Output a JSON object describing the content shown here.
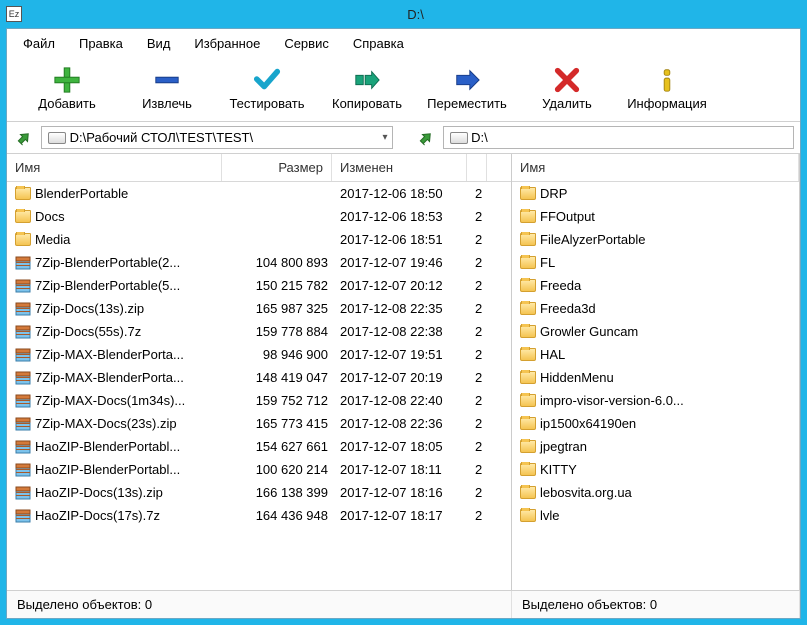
{
  "app_icon_text": "Ez",
  "window_title": "D:\\",
  "menu": [
    "Файл",
    "Правка",
    "Вид",
    "Избранное",
    "Сервис",
    "Справка"
  ],
  "toolbar": [
    {
      "key": "add",
      "label": "Добавить",
      "icon": "plus-icon"
    },
    {
      "key": "extract",
      "label": "Извлечь",
      "icon": "minus-icon"
    },
    {
      "key": "test",
      "label": "Тестировать",
      "icon": "check-icon"
    },
    {
      "key": "copy",
      "label": "Копировать",
      "icon": "copy-icon"
    },
    {
      "key": "move",
      "label": "Переместить",
      "icon": "move-icon"
    },
    {
      "key": "delete",
      "label": "Удалить",
      "icon": "delete-icon"
    },
    {
      "key": "info",
      "label": "Информация",
      "icon": "info-icon"
    }
  ],
  "panes": {
    "left": {
      "path": "D:\\Рабочий СТОЛ\\TEST\\TEST\\",
      "columns": [
        "Имя",
        "Размер",
        "Изменен",
        ""
      ],
      "status": "Выделено объектов: 0",
      "rows": [
        {
          "type": "folder",
          "name": "BlenderPortable",
          "size": "",
          "date": "2017-12-06 18:50",
          "x": "2"
        },
        {
          "type": "folder",
          "name": "Docs",
          "size": "",
          "date": "2017-12-06 18:53",
          "x": "2"
        },
        {
          "type": "folder",
          "name": "Media",
          "size": "",
          "date": "2017-12-06 18:51",
          "x": "2"
        },
        {
          "type": "arch",
          "name": "7Zip-BlenderPortable(2...",
          "size": "104 800 893",
          "date": "2017-12-07 19:46",
          "x": "2"
        },
        {
          "type": "arch",
          "name": "7Zip-BlenderPortable(5...",
          "size": "150 215 782",
          "date": "2017-12-07 20:12",
          "x": "2"
        },
        {
          "type": "arch",
          "name": "7Zip-Docs(13s).zip",
          "size": "165 987 325",
          "date": "2017-12-08 22:35",
          "x": "2"
        },
        {
          "type": "arch",
          "name": "7Zip-Docs(55s).7z",
          "size": "159 778 884",
          "date": "2017-12-08 22:38",
          "x": "2"
        },
        {
          "type": "arch",
          "name": "7Zip-MAX-BlenderPorta...",
          "size": "98 946 900",
          "date": "2017-12-07 19:51",
          "x": "2"
        },
        {
          "type": "arch",
          "name": "7Zip-MAX-BlenderPorta...",
          "size": "148 419 047",
          "date": "2017-12-07 20:19",
          "x": "2"
        },
        {
          "type": "arch",
          "name": "7Zip-MAX-Docs(1m34s)...",
          "size": "159 752 712",
          "date": "2017-12-08 22:40",
          "x": "2"
        },
        {
          "type": "arch",
          "name": "7Zip-MAX-Docs(23s).zip",
          "size": "165 773 415",
          "date": "2017-12-08 22:36",
          "x": "2"
        },
        {
          "type": "arch",
          "name": "HaoZIP-BlenderPortabl...",
          "size": "154 627 661",
          "date": "2017-12-07 18:05",
          "x": "2"
        },
        {
          "type": "arch",
          "name": "HaoZIP-BlenderPortabl...",
          "size": "100 620 214",
          "date": "2017-12-07 18:11",
          "x": "2"
        },
        {
          "type": "arch",
          "name": "HaoZIP-Docs(13s).zip",
          "size": "166 138 399",
          "date": "2017-12-07 18:16",
          "x": "2"
        },
        {
          "type": "arch",
          "name": "HaoZIP-Docs(17s).7z",
          "size": "164 436 948",
          "date": "2017-12-07 18:17",
          "x": "2"
        }
      ]
    },
    "right": {
      "path": "D:\\",
      "columns": [
        "Имя"
      ],
      "status": "Выделено объектов: 0",
      "rows": [
        {
          "type": "folder",
          "name": "DRP"
        },
        {
          "type": "folder",
          "name": "FFOutput"
        },
        {
          "type": "folder",
          "name": "FileAlyzerPortable"
        },
        {
          "type": "folder",
          "name": "FL"
        },
        {
          "type": "folder",
          "name": "Freeda"
        },
        {
          "type": "folder",
          "name": "Freeda3d"
        },
        {
          "type": "folder",
          "name": "Growler Guncam"
        },
        {
          "type": "folder",
          "name": "HAL"
        },
        {
          "type": "folder",
          "name": "HiddenMenu"
        },
        {
          "type": "folder",
          "name": "impro-visor-version-6.0..."
        },
        {
          "type": "folder",
          "name": "ip1500x64190en"
        },
        {
          "type": "folder",
          "name": "jpegtran"
        },
        {
          "type": "folder",
          "name": "KITTY"
        },
        {
          "type": "folder",
          "name": "lebosvita.org.ua"
        },
        {
          "type": "folder",
          "name": "lvle"
        }
      ]
    }
  }
}
